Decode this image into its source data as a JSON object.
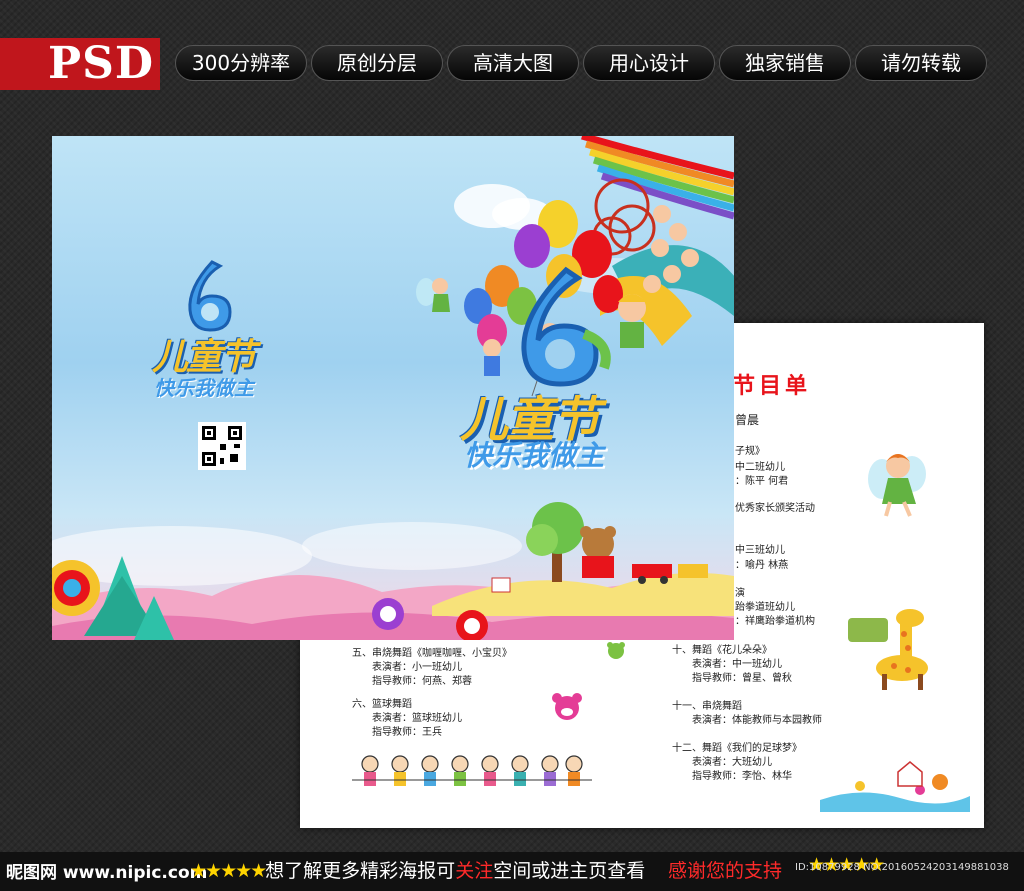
{
  "header": {
    "badge": "PSD",
    "tags": [
      "300分辨率",
      "原创分层",
      "高清大图",
      "用心设计",
      "独家销售",
      "请勿转载"
    ]
  },
  "cover": {
    "small_logo": {
      "number": "6",
      "title": "儿童节",
      "slogan": "快乐我做主"
    },
    "big_logo": {
      "number": "6",
      "title": "儿童节",
      "slogan": "快乐我做主"
    }
  },
  "program": {
    "title": "节目单",
    "left_column": [
      "五、串烧舞蹈《咖喱咖喱、小宝贝》",
      "表演者：小一班幼儿",
      "指导教师：何燕、郑蓉",
      "六、篮球舞蹈",
      "表演者：篮球班幼儿",
      "指导教师：王兵"
    ],
    "right_column": [
      "曾晨",
      "子规》",
      "中二班幼儿",
      "：陈平  何君",
      "优秀家长颁奖活动",
      "中三班幼儿",
      "：喻丹  林燕",
      "演",
      "跆拳道班幼儿",
      "：祥鹰跆拳道机构",
      "十、舞蹈《花儿朵朵》",
      "表演者：中一班幼儿",
      "指导教师：曾星、曾秋",
      "十一、串烧舞蹈",
      "表演者：体能教师与本园教师",
      "十二、舞蹈《我们的足球梦》",
      "表演者：大班幼儿",
      "指导教师：李怡、林华"
    ]
  },
  "footer": {
    "site": "昵图网 www.nipic.com",
    "stars_left": "★★★★★",
    "text_part1": "想了解更多精彩海报可",
    "text_highlight": "关注",
    "text_part2": "空间或进主页查看",
    "thanks": "感谢您的支持",
    "stars_right": "★★★★★",
    "id": "ID:10879928 NO:20160524203149881038"
  },
  "colors": {
    "badge_red": "#c0161c",
    "program_title_red": "#e8141b",
    "footer_yellow": "#ffd400",
    "footer_red": "#ff2a2a"
  }
}
